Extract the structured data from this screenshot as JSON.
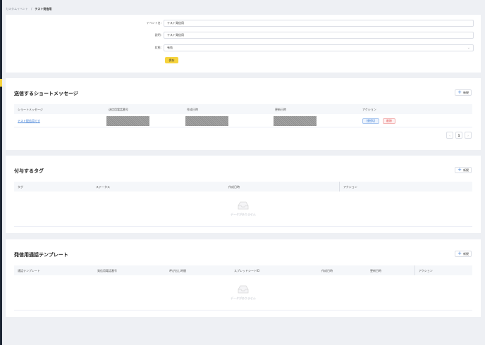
{
  "breadcrumb": {
    "parent": "カスタムイベント",
    "separator": "/",
    "current": "テスト発信用"
  },
  "form": {
    "event_label": "イベント名:",
    "event_value": "テスト発信用",
    "desc_label": "説明:",
    "desc_value": "テスト発信用",
    "status_label": "状態:",
    "status_value": "有効",
    "save_label": "保存"
  },
  "sms": {
    "title": "送信するショートメッセージ",
    "add_label": "新規",
    "columns": [
      "ショートメッセージ",
      "送信用電話番号",
      "作成日時",
      "更新日時",
      "アクション"
    ],
    "rows": [
      {
        "message": "テスト配信用です",
        "edit_label": "接続切",
        "delete_label": "削除"
      }
    ],
    "pager": {
      "prev": "‹",
      "page": "1",
      "next": "›"
    }
  },
  "tags": {
    "title": "付与するタグ",
    "add_label": "新規",
    "columns": [
      "タグ",
      "ステータス",
      "作成日時",
      "アクション"
    ],
    "empty_text": "データがありません"
  },
  "templates": {
    "title": "発信用通話テンプレート",
    "add_label": "新規",
    "columns": [
      "通話テンプレート",
      "発信用電話番号",
      "呼び出し時間",
      "スプレッドシートID",
      "作成日時",
      "更新日時",
      "アクション"
    ],
    "empty_text": "データがありません"
  },
  "colors": {
    "accent": "#f6d33c",
    "link": "#3a7bd5",
    "danger": "#e04444",
    "sidebar": "#1d2634"
  }
}
